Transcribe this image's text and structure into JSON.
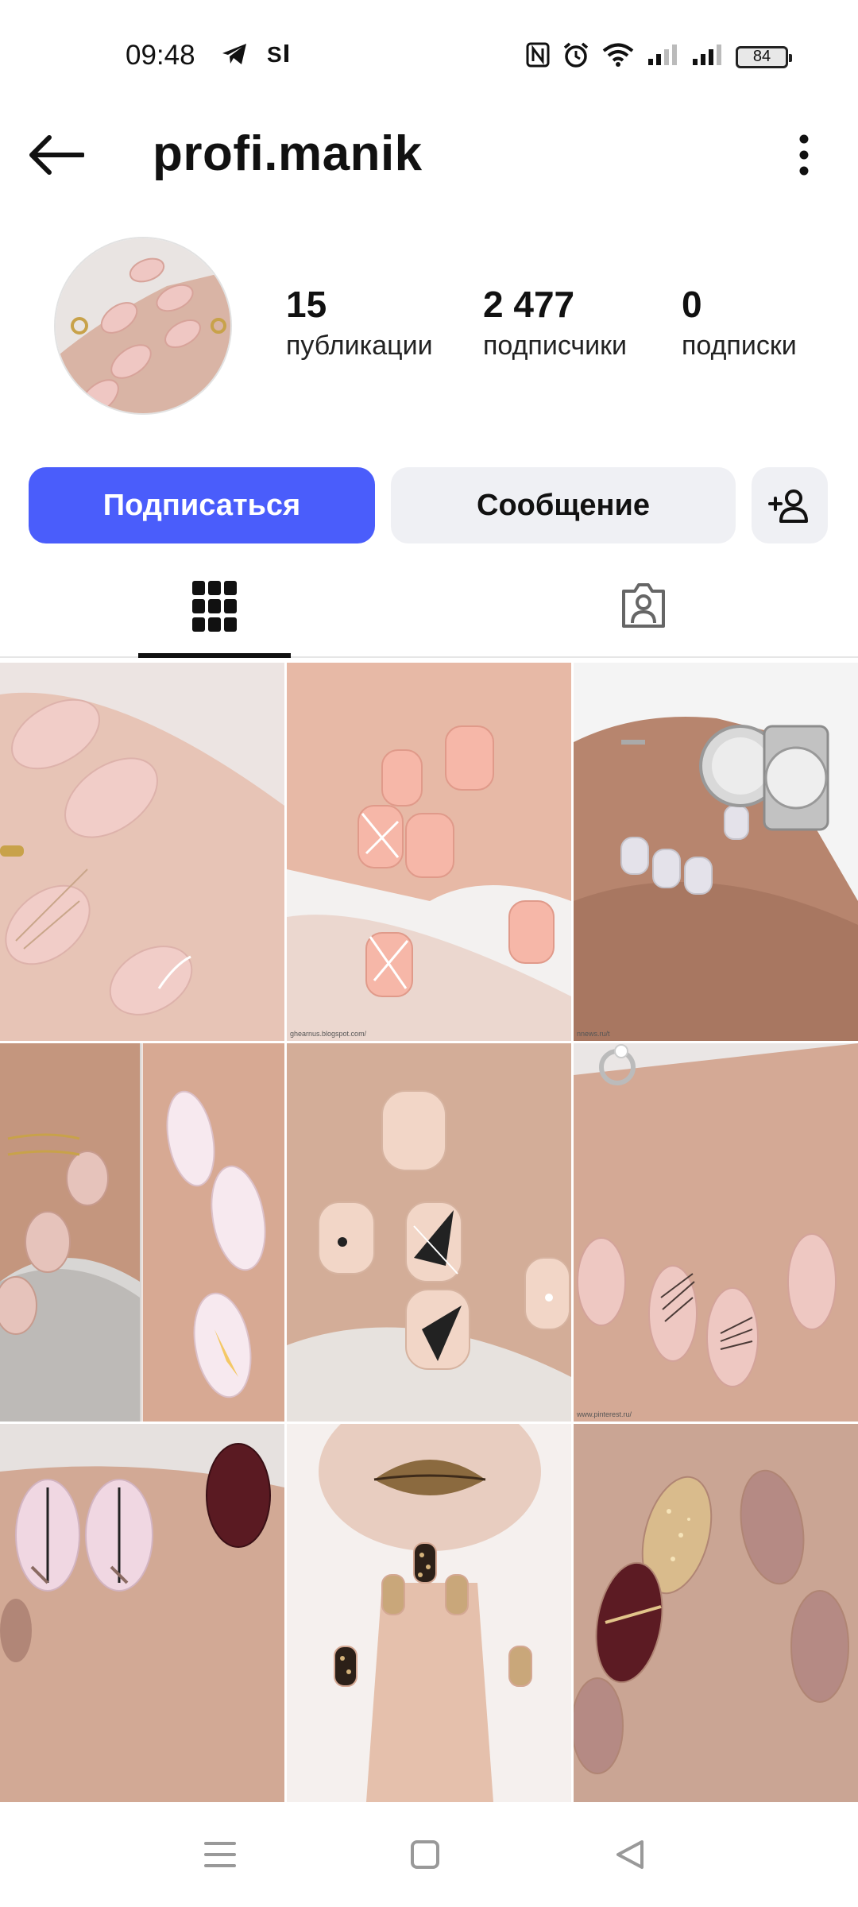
{
  "status_bar": {
    "time": "09:48",
    "battery": "84",
    "icons": [
      "telegram-icon",
      "sim-icon",
      "nfc-icon",
      "alarm-icon",
      "wifi-icon",
      "signal-icon",
      "signal-icon",
      "battery-icon"
    ]
  },
  "header": {
    "username": "profi.manik",
    "back_icon": "arrow-left-icon",
    "menu_icon": "more-vertical-icon"
  },
  "profile": {
    "stats": [
      {
        "value": "15",
        "label": "публикации"
      },
      {
        "value": "2 477",
        "label": "подписчики"
      },
      {
        "value": "0",
        "label": "подписки"
      }
    ]
  },
  "actions": {
    "follow_label": "Подписаться",
    "message_label": "Сообщение",
    "add_user_icon": "add-user-icon"
  },
  "colors": {
    "accent": "#4a5dfb",
    "button_secondary": "#eff0f4"
  },
  "tabs": [
    {
      "icon": "grid-icon",
      "selected": true
    },
    {
      "icon": "tagged-person-icon",
      "selected": false
    }
  ],
  "posts": [
    {
      "caption": ""
    },
    {
      "caption": "ghearnus.blogspot.com/"
    },
    {
      "caption": "nnews.ru/t"
    },
    {
      "caption": ""
    },
    {
      "caption": ""
    },
    {
      "caption": "www.pinterest.ru/"
    },
    {
      "caption": ""
    },
    {
      "caption": ""
    },
    {
      "caption": ""
    }
  ],
  "nav": [
    "menu-icon",
    "home-square-icon",
    "back-triangle-icon"
  ]
}
